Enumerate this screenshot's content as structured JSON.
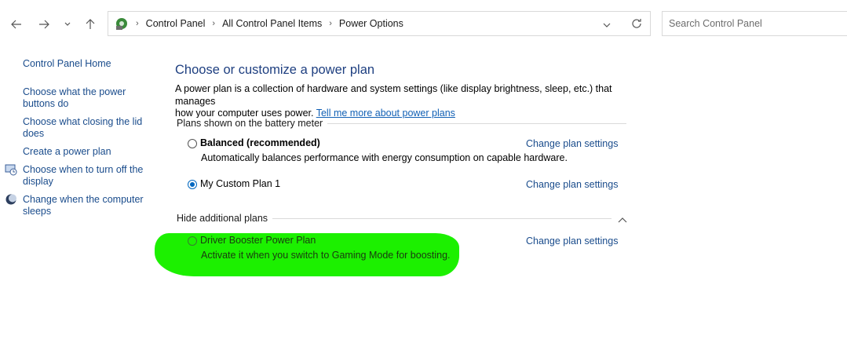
{
  "toolbar": {
    "back_icon": "arrow-left-icon",
    "forward_icon": "arrow-right-icon",
    "recent_icon": "chevron-down-icon",
    "up_icon": "arrow-up-icon"
  },
  "address": {
    "crumbs": [
      "Control Panel",
      "All Control Panel Items",
      "Power Options"
    ],
    "dropdown_icon": "chevron-down-icon",
    "refresh_icon": "refresh-icon"
  },
  "search": {
    "placeholder": "Search Control Panel"
  },
  "sidebar": {
    "home": "Control Panel Home",
    "items": [
      {
        "label_1": "Choose what the power",
        "label_2": "buttons do"
      },
      {
        "label_1": "Choose what closing the lid",
        "label_2": "does"
      },
      {
        "label_1": "Create a power plan"
      },
      {
        "label_1": "Choose when to turn off the",
        "label_2": "display",
        "icon": "monitor-icon"
      },
      {
        "label_1": "Change when the computer",
        "label_2": "sleeps",
        "icon": "moon-icon"
      }
    ]
  },
  "main": {
    "title": "Choose or customize a power plan",
    "desc_line1": "A power plan is a collection of hardware and system settings (like display brightness, sleep, etc.) that manages",
    "desc_line2": "how your computer uses power.",
    "desc_link": "Tell me more about power plans",
    "battery_group_label": "Plans shown on the battery meter",
    "plans": [
      {
        "name": "Balanced (recommended)",
        "desc": "Automatically balances performance with energy consumption on capable hardware.",
        "selected": false,
        "change_label": "Change plan settings"
      },
      {
        "name": "My Custom Plan 1",
        "desc": "",
        "selected": true,
        "change_label": "Change plan settings"
      }
    ],
    "additional_group_label": "Hide additional plans",
    "additional_plans": [
      {
        "name": "Driver Booster Power Plan",
        "desc": "Activate it when you switch to Gaming Mode for boosting.",
        "selected": false,
        "change_label": "Change plan settings"
      }
    ]
  },
  "colors": {
    "link": "#1a4c8c",
    "title": "#1e3f80",
    "radio_selected": "#0067c0",
    "highlight_marker": "#1cf000"
  }
}
